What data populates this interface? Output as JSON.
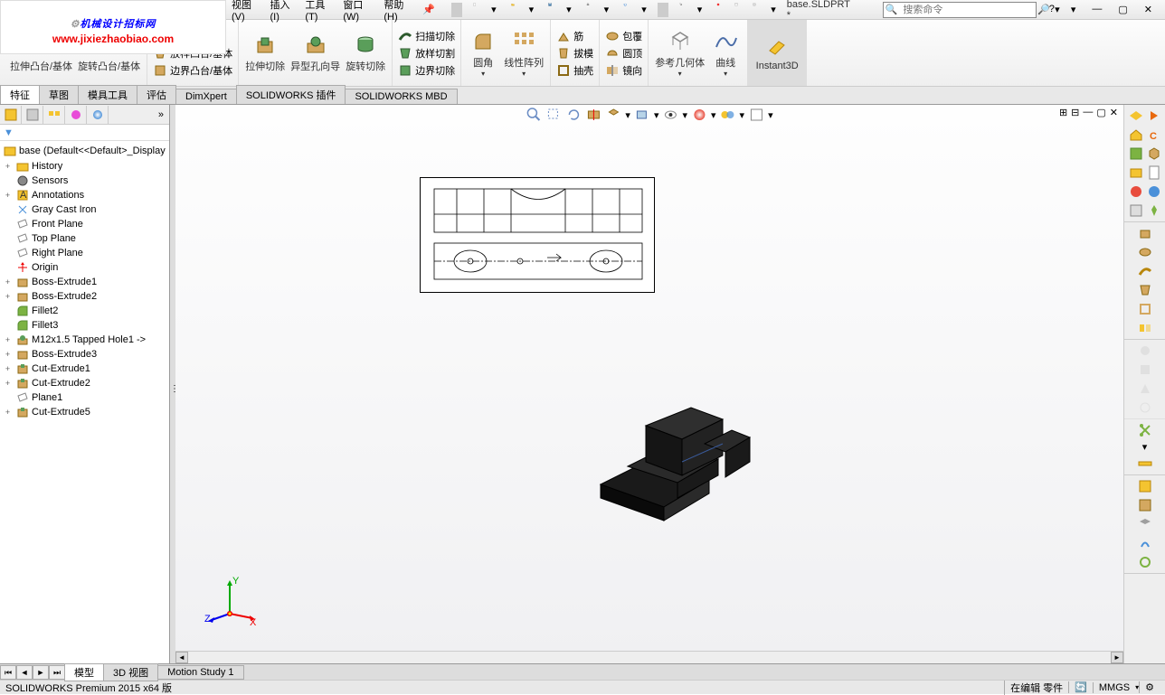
{
  "menubar": {
    "items": [
      "视图(V)",
      "插入(I)",
      "工具(T)",
      "窗口(W)",
      "帮助(H)"
    ],
    "filename": "base.SLDPRT *",
    "search_placeholder": "搜索命令"
  },
  "logo": {
    "line1_a": "机械设计",
    "line1_b": "招标网",
    "url": "www.jixiezhaobiao.com"
  },
  "ribbon": {
    "col1": {
      "a": "拉伸凸台/基体",
      "b": "旋转凸台/基体"
    },
    "col2": [
      "放样凸台/基体",
      "边界凸台/基体"
    ],
    "col3": {
      "a": "拉伸切除",
      "b": "异型孔向导",
      "c": "旋转切除"
    },
    "col4": [
      "扫描切除",
      "放样切割",
      "边界切除"
    ],
    "col5": {
      "a": "圆角",
      "b": "线性阵列"
    },
    "col6": [
      "筋",
      "拔模",
      "抽壳"
    ],
    "col7": [
      "包覆",
      "圆顶",
      "镜向"
    ],
    "col8": {
      "a": "参考几何体",
      "b": "曲线"
    },
    "col9": "Instant3D"
  },
  "tabs": [
    "特征",
    "草图",
    "模具工具",
    "评估",
    "DimXpert",
    "SOLIDWORKS 插件",
    "SOLIDWORKS MBD"
  ],
  "tree": {
    "root": "base  (Default<<Default>_Display",
    "items": [
      {
        "exp": "+",
        "icon": "folder",
        "label": "History"
      },
      {
        "exp": "",
        "icon": "sensor",
        "label": "Sensors"
      },
      {
        "exp": "+",
        "icon": "annotation",
        "label": "Annotations"
      },
      {
        "exp": "",
        "icon": "material",
        "label": "Gray Cast Iron"
      },
      {
        "exp": "",
        "icon": "plane",
        "label": "Front Plane"
      },
      {
        "exp": "",
        "icon": "plane",
        "label": "Top Plane"
      },
      {
        "exp": "",
        "icon": "plane",
        "label": "Right Plane"
      },
      {
        "exp": "",
        "icon": "origin",
        "label": "Origin"
      },
      {
        "exp": "+",
        "icon": "extrude",
        "label": "Boss-Extrude1"
      },
      {
        "exp": "+",
        "icon": "extrude",
        "label": "Boss-Extrude2"
      },
      {
        "exp": "",
        "icon": "fillet",
        "label": "Fillet2"
      },
      {
        "exp": "",
        "icon": "fillet",
        "label": "Fillet3"
      },
      {
        "exp": "+",
        "icon": "hole",
        "label": "M12x1.5 Tapped Hole1 ->"
      },
      {
        "exp": "+",
        "icon": "extrude",
        "label": "Boss-Extrude3"
      },
      {
        "exp": "+",
        "icon": "cut",
        "label": "Cut-Extrude1"
      },
      {
        "exp": "+",
        "icon": "cut",
        "label": "Cut-Extrude2"
      },
      {
        "exp": "",
        "icon": "plane",
        "label": "Plane1"
      },
      {
        "exp": "+",
        "icon": "cut",
        "label": "Cut-Extrude5"
      }
    ]
  },
  "bottom_tabs": [
    "模型",
    "3D 视图",
    "Motion Study 1"
  ],
  "triad": {
    "x": "X",
    "y": "Y",
    "z": "Z"
  },
  "statusbar": {
    "left": "SOLIDWORKS Premium 2015 x64 版",
    "edit": "在编辑 零件",
    "units": "MMGS"
  }
}
